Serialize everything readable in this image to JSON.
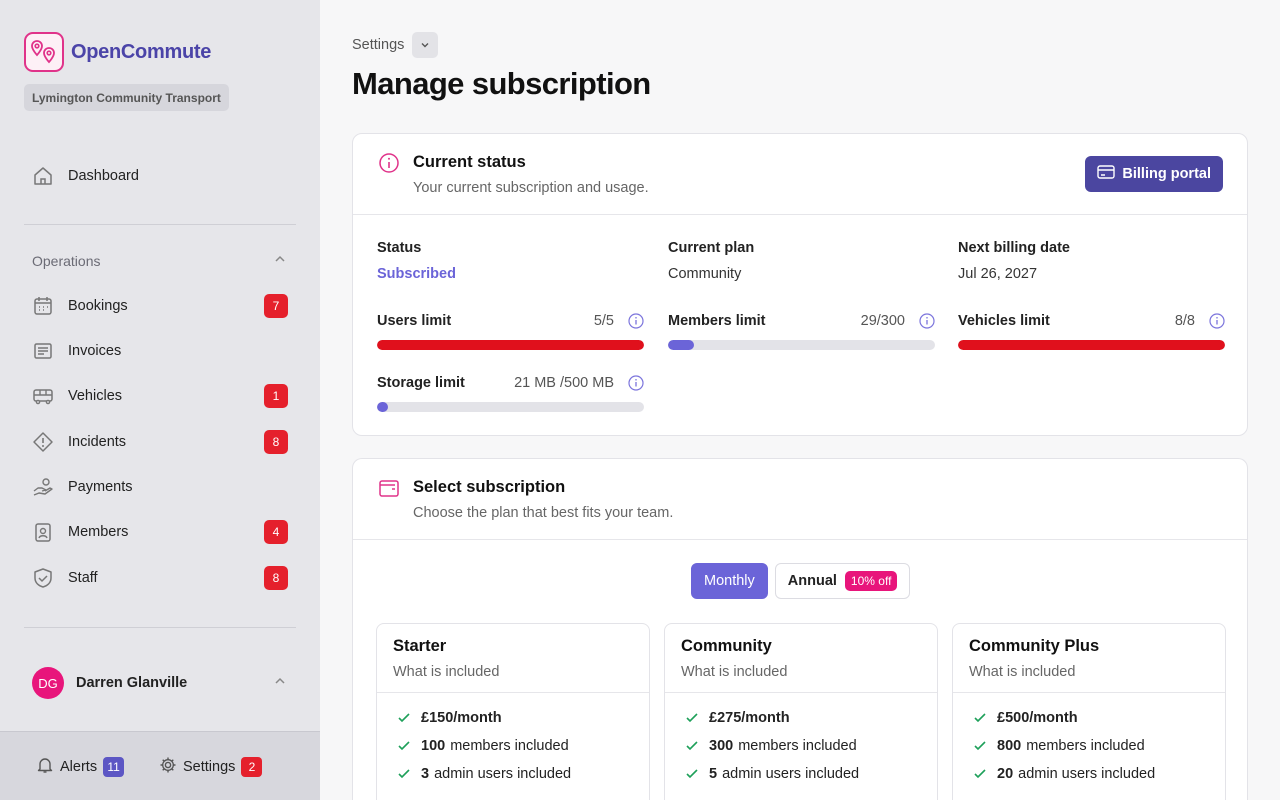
{
  "app": {
    "name": "OpenCommute",
    "organization": "Lymington Community Transport"
  },
  "sidebar": {
    "dashboard": {
      "label": "Dashboard"
    },
    "operations_label": "Operations",
    "items": [
      {
        "label": "Bookings",
        "icon": "calendar-icon",
        "badge": "7"
      },
      {
        "label": "Invoices",
        "icon": "receipt-icon",
        "badge": ""
      },
      {
        "label": "Vehicles",
        "icon": "bus-icon",
        "badge": "1"
      },
      {
        "label": "Incidents",
        "icon": "alert-diamond-icon",
        "badge": "8"
      },
      {
        "label": "Payments",
        "icon": "hand-coins-icon",
        "badge": ""
      },
      {
        "label": "Members",
        "icon": "id-badge-icon",
        "badge": "4"
      },
      {
        "label": "Staff",
        "icon": "shield-check-icon",
        "badge": "8"
      }
    ],
    "user": {
      "initials": "DG",
      "name": "Darren Glanville"
    },
    "footer": {
      "alerts_label": "Alerts",
      "alerts_count": "11",
      "settings_label": "Settings",
      "settings_count": "2"
    }
  },
  "main": {
    "breadcrumb": "Settings",
    "title": "Manage subscription",
    "status_card": {
      "title": "Current status",
      "subtitle": "Your current subscription and usage.",
      "billing_button": "Billing portal",
      "status_label": "Status",
      "status_value": "Subscribed",
      "plan_label": "Current plan",
      "plan_value": "Community",
      "billing_label": "Next billing date",
      "billing_value": "Jul 26, 2027",
      "limits": [
        {
          "label": "Users limit",
          "value": "5/5",
          "fraction": 1.0
        },
        {
          "label": "Members limit",
          "value": "29/300",
          "fraction": 0.0967
        },
        {
          "label": "Vehicles limit",
          "value": "8/8",
          "fraction": 1.0
        },
        {
          "label": "Storage limit",
          "value": "21 MB /500 MB",
          "fraction": 0.042
        }
      ]
    },
    "select_card": {
      "title": "Select subscription",
      "subtitle": "Choose the plan that best fits your team.",
      "monthly_label": "Monthly",
      "annual_label": "Annual",
      "discount": "10% off",
      "plans": [
        {
          "name": "Starter",
          "subtitle": "What is included",
          "features": [
            {
              "bold": "£150/month",
              "text": ""
            },
            {
              "bold": "100",
              "text": "members included"
            },
            {
              "bold": "3",
              "text": "admin users included"
            }
          ]
        },
        {
          "name": "Community",
          "subtitle": "What is included",
          "features": [
            {
              "bold": "£275/month",
              "text": ""
            },
            {
              "bold": "300",
              "text": "members included"
            },
            {
              "bold": "5",
              "text": "admin users included"
            }
          ]
        },
        {
          "name": "Community Plus",
          "subtitle": "What is included",
          "features": [
            {
              "bold": "£500/month",
              "text": ""
            },
            {
              "bold": "800",
              "text": "members included"
            },
            {
              "bold": "20",
              "text": "admin users included"
            }
          ]
        }
      ]
    }
  },
  "colors": {
    "brand": "#4b44a8",
    "accent": "#6b64d8",
    "danger": "#e5202c",
    "pink": "#e8157b",
    "limit_full": "#e0101c",
    "limit_ok": "#6b64d8"
  }
}
